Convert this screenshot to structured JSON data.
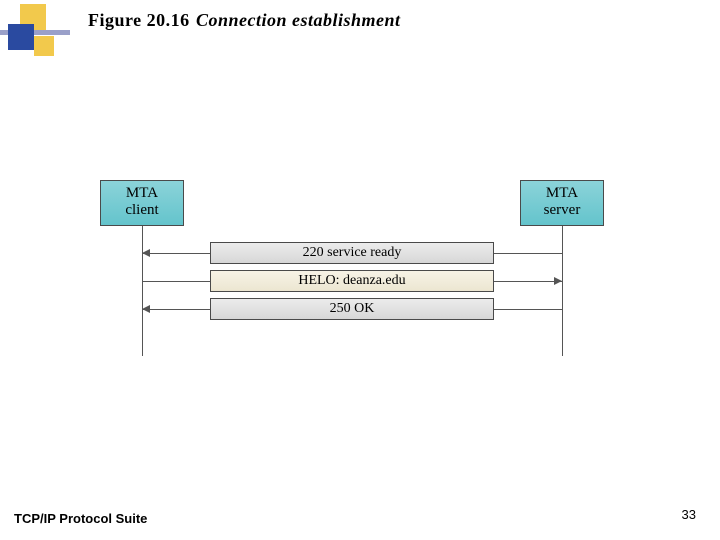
{
  "header": {
    "figure_number": "Figure 20.16",
    "caption": "Connection establishment"
  },
  "logo": {
    "colors": {
      "yellow": "#f2c94c",
      "blue": "#2a4aa0",
      "divider": "#9aa0c9"
    }
  },
  "diagram": {
    "client_box": {
      "line1": "MTA",
      "line2": "client"
    },
    "server_box": {
      "line1": "MTA",
      "line2": "server"
    },
    "messages": [
      {
        "text": "220 service ready",
        "direction": "to_client",
        "style": "gray"
      },
      {
        "text": "HELO: deanza.edu",
        "direction": "to_server",
        "style": "beige"
      },
      {
        "text": "250 OK",
        "direction": "to_client",
        "style": "gray"
      }
    ]
  },
  "footer": {
    "left": "TCP/IP Protocol Suite",
    "page": "33"
  }
}
